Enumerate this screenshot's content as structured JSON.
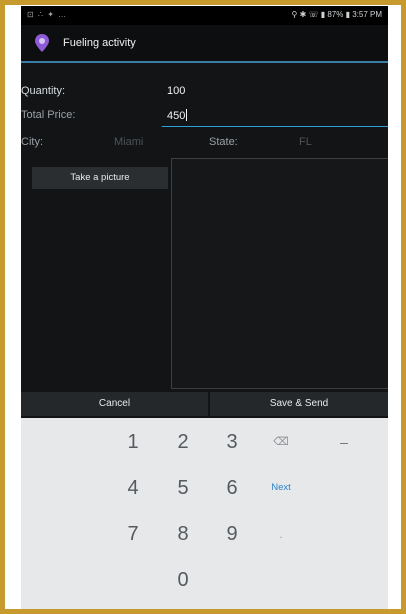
{
  "status_bar": {
    "left_icons": "⊡ ∴ ✦ …",
    "right_text": "⚲ ✱ ☏ ▮ 87% ▮ 3:57 PM"
  },
  "action_bar": {
    "icon": "location-pin-icon",
    "title": "Fueling activity"
  },
  "form": {
    "quantity_label": "Quantity:",
    "quantity_value": "100",
    "total_price_label": "Total Price:",
    "total_price_value": "450",
    "city_label": "City:",
    "city_value": "Miami",
    "state_label": "State:",
    "state_value": "FL"
  },
  "buttons": {
    "take_picture": "Take a picture",
    "cancel": "Cancel",
    "save_send": "Save & Send"
  },
  "keypad": {
    "k1": "1",
    "k2": "2",
    "k3": "3",
    "k4": "4",
    "k5": "5",
    "k6": "6",
    "k7": "7",
    "k8": "8",
    "k9": "9",
    "k0": "0",
    "backspace": "⌫",
    "dash": "–",
    "next": "Next",
    "dot": "."
  },
  "colors": {
    "accent": "#2f9fd6",
    "frame": "#c79a2e",
    "background": "#121416"
  }
}
